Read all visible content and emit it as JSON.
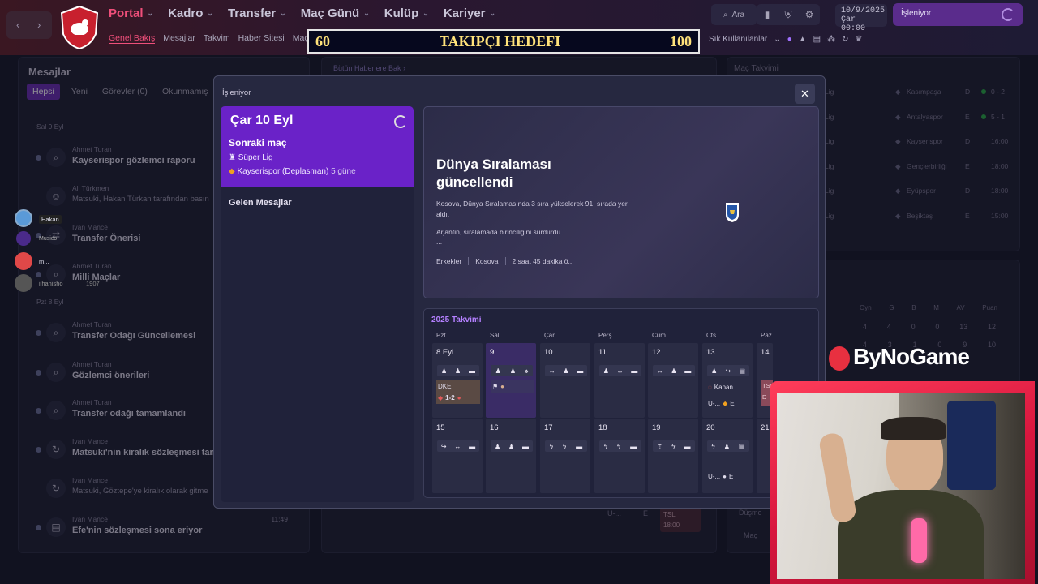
{
  "topbar": {
    "menu": [
      "Portal",
      "Kadro",
      "Transfer",
      "Maç Günü",
      "Kulüp",
      "Kariyer"
    ],
    "submenu": [
      "Genel Bakış",
      "Mesajlar",
      "Takvim",
      "Haber Sitesi",
      "Maç T"
    ],
    "search_label": "Ara",
    "date_line1": "10/9/2025",
    "date_line2": "Çar  00:00",
    "busy_label": "İşleniyor",
    "sik_label": "Sık Kullanılanlar"
  },
  "banner": {
    "left_value": "60",
    "title": "TAKIPÇI HEDEFI",
    "right_value": "100"
  },
  "messages": {
    "title": "Mesajlar",
    "filters": [
      "Hepsi",
      "Yeni",
      "Görevler (0)",
      "Okunmamış"
    ],
    "day1": "Sal 9 Eyl",
    "day2": "Pzt 8 Eyl",
    "items": [
      {
        "from": "Ahmet Turan",
        "subject": "Kayserispor gözlemci raporu"
      },
      {
        "from": "Ali Türkmen",
        "subject": "Matsuki, Hakan Türkan tarafından basın"
      },
      {
        "from": "Ivan Mance",
        "subject": "Transfer Önerisi"
      },
      {
        "from": "Ahmet Turan",
        "subject": "Milli Maçlar"
      },
      {
        "from": "Ahmet Turan",
        "subject": "Transfer Odağı Güncellemesi"
      },
      {
        "from": "Ahmet Turan",
        "subject": "Gözlemci önerileri"
      },
      {
        "from": "Ahmet Turan",
        "subject": "Transfer odağı tamamlandı"
      },
      {
        "from": "Ivan Mance",
        "subject": "Matsuki'nin kiralık sözleşmesi tam"
      },
      {
        "from": "Ivan Mance",
        "subject": "Matsuki, Göztepe'ye kiralık olarak gitme"
      },
      {
        "from": "Ivan Mance",
        "subject": "Efe'nin sözleşmesi sona eriyor",
        "time": "11:49"
      }
    ]
  },
  "background": {
    "news_link": "Bütün Haberlere Bak",
    "fixtures_title": "Maç Takvimi",
    "fixtures": [
      {
        "comp": "Lig",
        "team": "Kasımpaşa",
        "venue": "D",
        "score": "0 - 2"
      },
      {
        "comp": "Lig",
        "team": "Antalyaspor",
        "venue": "E",
        "score": "5 - 1"
      },
      {
        "comp": "Lig",
        "team": "Kayserispor",
        "venue": "D",
        "score": "16:00"
      },
      {
        "comp": "Lig",
        "team": "Gençlerbirliği",
        "venue": "E",
        "score": "18:00"
      },
      {
        "comp": "Lig",
        "team": "Eyüpspor",
        "venue": "D",
        "score": "18:00"
      },
      {
        "comp": "Lig",
        "team": "Beşiktaş",
        "venue": "E",
        "score": "15:00"
      }
    ],
    "table_headers": [
      "Oyn",
      "G",
      "B",
      "M",
      "AV",
      "Puan"
    ],
    "table_row": [
      "4",
      "4",
      "0",
      "0",
      "13",
      "12"
    ],
    "table_row2": [
      "4",
      "3",
      "1",
      "0",
      "9",
      "10"
    ],
    "relegation": "Düşme",
    "mac_link": "Maç",
    "bottom_tsl": "TSL",
    "bottom_time": "18:00",
    "bottom_u": "U-...",
    "bottom_e": "E"
  },
  "modal": {
    "title": "İşleniyor",
    "next_match": {
      "date": "Çar 10 Eyl",
      "label": "Sonraki maç",
      "league": "Süper Lig",
      "opponent": "Kayserispor (Deplasman)",
      "days": "5 güne"
    },
    "inbox_label": "Gelen Mesajlar",
    "news": {
      "headline": "Dünya Sıralaması güncellendi",
      "body1": "Kosova, Dünya Sıralamasında 3 sıra yükselerek 91. sırada yer aldı.",
      "body2": "Arjantin, sıralamada birinciliğini sürdürdü.",
      "body3": "...",
      "tags": [
        "Erkekler",
        "Kosova",
        "2 saat 45 dakika ö..."
      ]
    },
    "calendar": {
      "title": "2025 Takvimi",
      "days_of_week": [
        "Pzt",
        "Sal",
        "Çar",
        "Perş",
        "Cum",
        "Cts",
        "Paz"
      ],
      "week1": [
        "8 Eyl",
        "9",
        "10",
        "11",
        "12",
        "13",
        "14"
      ],
      "week2": [
        "15",
        "16",
        "17",
        "18",
        "19",
        "20",
        "21"
      ],
      "event_dke": "DKE",
      "event_dke_score": "1-2",
      "event_kapan": "Kapan...",
      "event_u1": "U-...",
      "event_e": "E",
      "event_tsl": "TSL",
      "event_d": "D",
      "event_u2": "U-..."
    }
  },
  "overlay": {
    "user1": "Hakan",
    "user2": "Musico",
    "user3": "m...",
    "user4": "ilhanisho",
    "user4_sub": "1907",
    "logo_text": "ByNoGame"
  },
  "colors": {
    "accent": "#6a22c8",
    "portal": "#ef4f7a",
    "banner_text": "#ffe27a",
    "busy": "#5a2c8c",
    "webcam_frame": "#e8203f"
  }
}
